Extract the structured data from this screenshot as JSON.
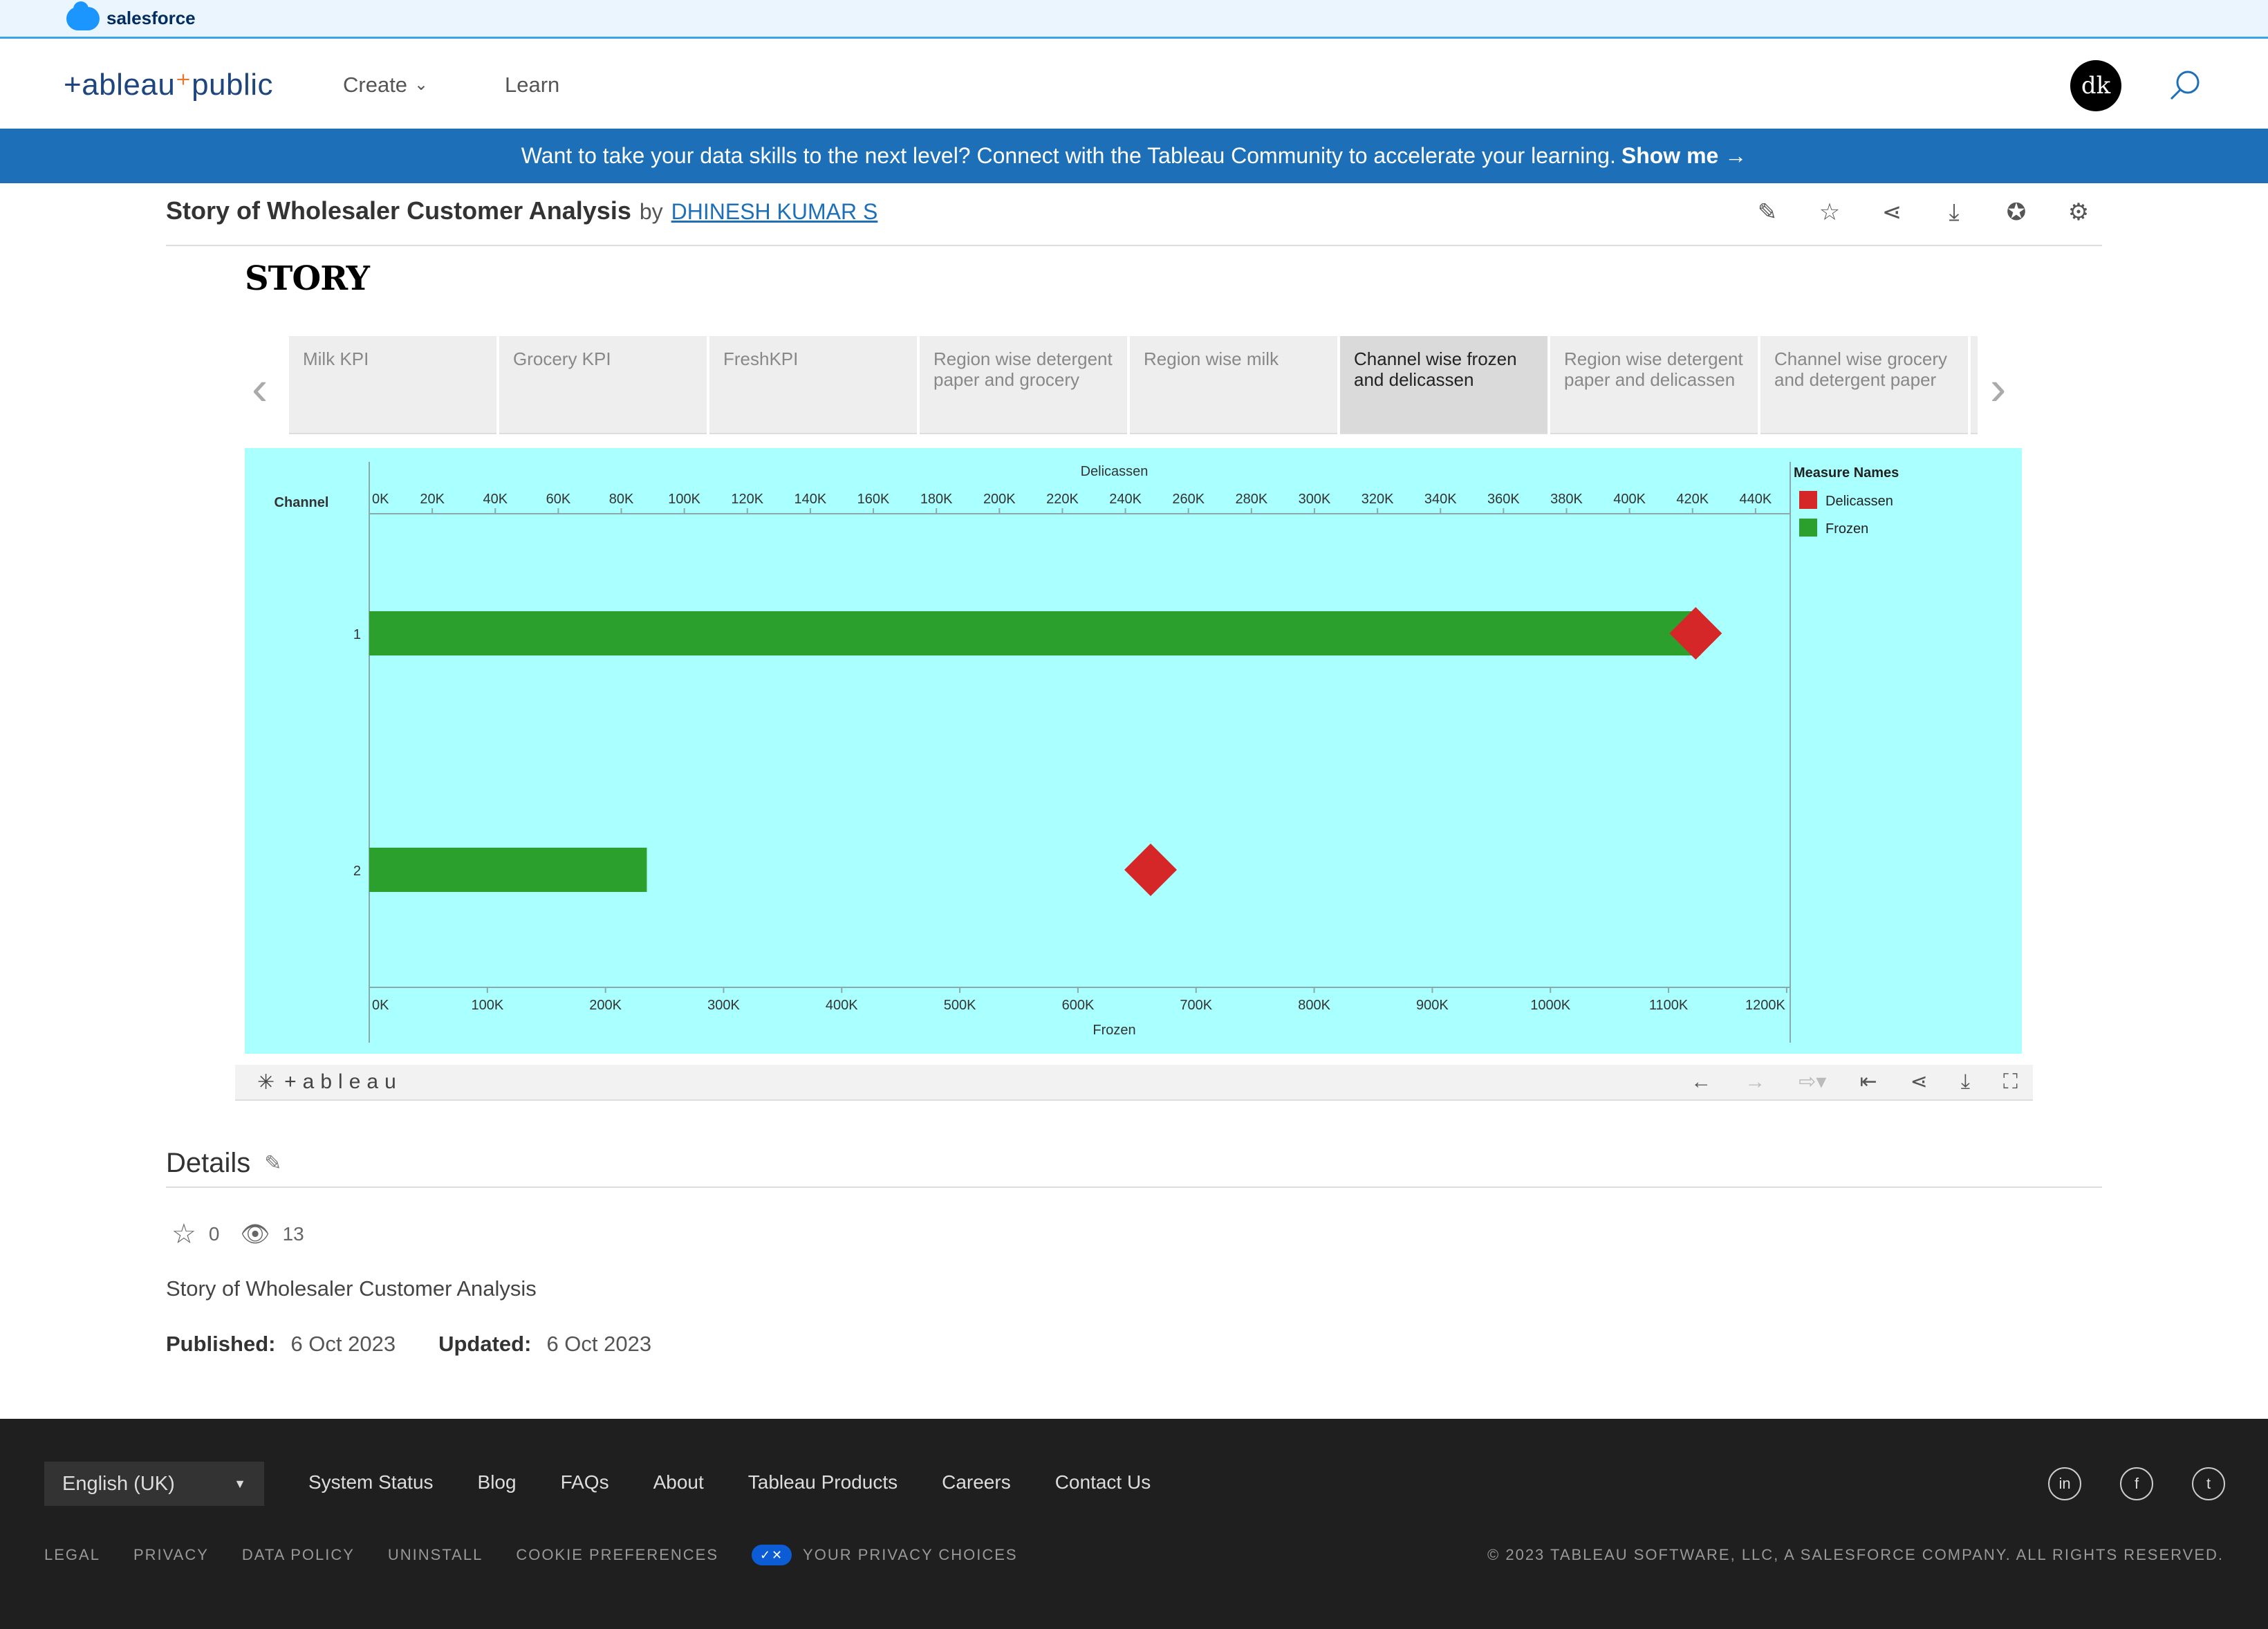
{
  "salesforce": {
    "brand": "salesforce"
  },
  "nav": {
    "brand_prefix": "+ableau",
    "brand_suffix": "public",
    "create": "Create",
    "learn": "Learn",
    "avatar_text": "dk"
  },
  "banner": {
    "text": "Want to take your data skills to the next level? Connect with the Tableau Community to accelerate your learning.",
    "cta": "Show me →"
  },
  "viz": {
    "title": "Story of Wholesaler Customer Analysis",
    "by": "by",
    "author": "DHINESH KUMAR S"
  },
  "story": {
    "title": "STORY",
    "tabs": [
      "Milk KPI",
      "Grocery KPI",
      "FreshKPI",
      "Region wise detergent paper and grocery",
      "Region wise milk",
      "Channel wise frozen and delicassen",
      "Region wise detergent paper and delicassen",
      "Channel wise grocery and detergent paper"
    ],
    "active_index": 5
  },
  "chart_data": {
    "type": "bar",
    "row_axis_label": "Channel",
    "categories": [
      "1",
      "2"
    ],
    "top_axis": {
      "label": "Delicassen",
      "ticks": [
        "0K",
        "20K",
        "40K",
        "60K",
        "80K",
        "100K",
        "120K",
        "140K",
        "160K",
        "180K",
        "200K",
        "220K",
        "240K",
        "260K",
        "280K",
        "300K",
        "320K",
        "340K",
        "360K",
        "380K",
        "400K",
        "420K",
        "440K"
      ],
      "range": [
        0,
        451000
      ]
    },
    "bottom_axis": {
      "label": "Frozen",
      "ticks": [
        "0K",
        "100K",
        "200K",
        "300K",
        "400K",
        "500K",
        "600K",
        "700K",
        "800K",
        "900K",
        "1000K",
        "1100K",
        "1200K"
      ],
      "range": [
        0,
        1203000
      ]
    },
    "series": [
      {
        "name": "Frozen",
        "mark": "bar",
        "color": "#2ca02c",
        "values": [
          1127000,
          235000
        ]
      },
      {
        "name": "Delicassen",
        "mark": "diamond",
        "color": "#d62728",
        "values": [
          421000,
          248000
        ]
      }
    ],
    "legend": {
      "title": "Measure Names",
      "position": "right",
      "items": [
        {
          "label": "Delicassen",
          "color": "#d62728"
        },
        {
          "label": "Frozen",
          "color": "#2ca02c"
        }
      ]
    },
    "background": "#aaffff"
  },
  "tableau_toolbar": {
    "logo": "+ableau"
  },
  "details": {
    "heading": "Details",
    "favorites": "0",
    "views": "13",
    "description": "Story of Wholesaler Customer Analysis",
    "published_label": "Published:",
    "published": "6 Oct 2023",
    "updated_label": "Updated:",
    "updated": "6 Oct 2023"
  },
  "footer": {
    "language": "English (UK)",
    "links": [
      "System Status",
      "Blog",
      "FAQs",
      "About",
      "Tableau Products",
      "Careers",
      "Contact Us"
    ],
    "legal": [
      "LEGAL",
      "PRIVACY",
      "DATA POLICY",
      "UNINSTALL",
      "COOKIE PREFERENCES"
    ],
    "privacy_choices": "YOUR PRIVACY CHOICES",
    "copyright": "© 2023 TABLEAU SOFTWARE, LLC, A SALESFORCE COMPANY. ALL RIGHTS RESERVED.",
    "social": [
      "in",
      "f",
      "t"
    ]
  }
}
